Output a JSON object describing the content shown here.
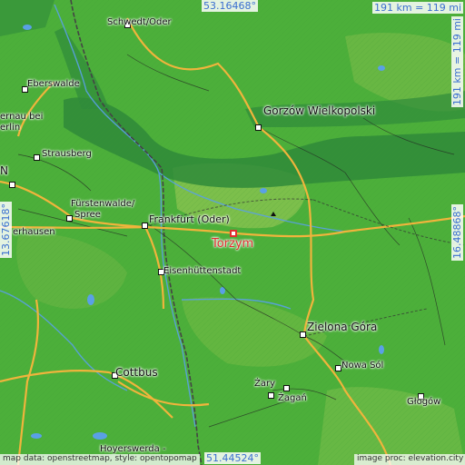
{
  "map": {
    "coordinates": {
      "top_lat": "53.16468°",
      "bottom_lat": "51.44524°",
      "left_lon": "13.67618°",
      "right_lon": "16.48868°"
    },
    "scale": {
      "horizontal": "191 km = 119 mi",
      "vertical": "191 km = 119 mi"
    },
    "target": {
      "name": "Torzym"
    },
    "places": {
      "schwedt": "Schwedt/Oder",
      "eberswalde": "Eberswalde",
      "bernau": "ernau bei",
      "berlin": "erlin",
      "strausberg": "Strausberg",
      "fuerstenwalde": "Fürstenwalde/",
      "spree": "Spree",
      "erhausen": "erhausen",
      "frankfurt": "Frankfurt (Oder)",
      "gorzow": "Gorzów Wielkopolski",
      "eisenhuettenstadt": "Eisenhüttenstadt",
      "zielona": "Zielona Góra",
      "nowasol": "Nowa Sól",
      "cottbus": "Cottbus",
      "zary": "Żary",
      "zagan": "Żagań",
      "glogow": "Głogów",
      "hoyerswerda": "Hoyerswerda -",
      "n_edge": "N"
    },
    "credits": {
      "left": "map data: openstreetmap, style: opentopomap",
      "right": "image proc: elevation.city"
    },
    "colors": {
      "lowland": "#4caf3a",
      "valley": "#2f8a3a",
      "highland": "#8cc452",
      "water": "#5aa0e6",
      "border": "#444444",
      "road_major": "#f0b43c",
      "target": "#e03030",
      "coord_text": "#3a6fd0"
    }
  }
}
